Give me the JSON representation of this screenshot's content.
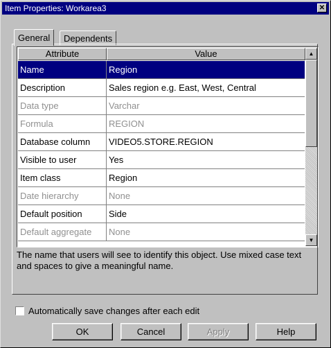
{
  "window": {
    "title": "Item Properties: Workarea3",
    "close_glyph": "✕"
  },
  "tabs": [
    {
      "label": "General",
      "active": true
    },
    {
      "label": "Dependents",
      "active": false
    }
  ],
  "grid": {
    "columns": [
      "Attribute",
      "Value"
    ],
    "rows": [
      {
        "attribute": "Name",
        "value": "Region",
        "state": "selected"
      },
      {
        "attribute": "Description",
        "value": "Sales region e.g. East, West, Central",
        "state": "normal"
      },
      {
        "attribute": "Data type",
        "value": "Varchar",
        "state": "disabled"
      },
      {
        "attribute": "Formula",
        "value": "REGION",
        "state": "disabled"
      },
      {
        "attribute": "Database column",
        "value": "VIDEO5.STORE.REGION",
        "state": "normal"
      },
      {
        "attribute": "Visible to user",
        "value": "Yes",
        "state": "normal"
      },
      {
        "attribute": "Item class",
        "value": "Region",
        "state": "normal"
      },
      {
        "attribute": "Date hierarchy",
        "value": "None",
        "state": "disabled"
      },
      {
        "attribute": "Default position",
        "value": "Side",
        "state": "normal"
      },
      {
        "attribute": "Default aggregate",
        "value": "None",
        "state": "disabled"
      }
    ]
  },
  "description": "The name that users will see to identify this object. Use mixed case text and spaces to give a meaningful name.",
  "autosave": {
    "label": "Automatically save changes after each edit",
    "checked": false
  },
  "buttons": {
    "ok": "OK",
    "cancel": "Cancel",
    "apply": "Apply",
    "help": "Help"
  },
  "icons": {
    "scroll_up": "scroll-up-arrow-icon",
    "scroll_down": "scroll-down-arrow-icon"
  }
}
